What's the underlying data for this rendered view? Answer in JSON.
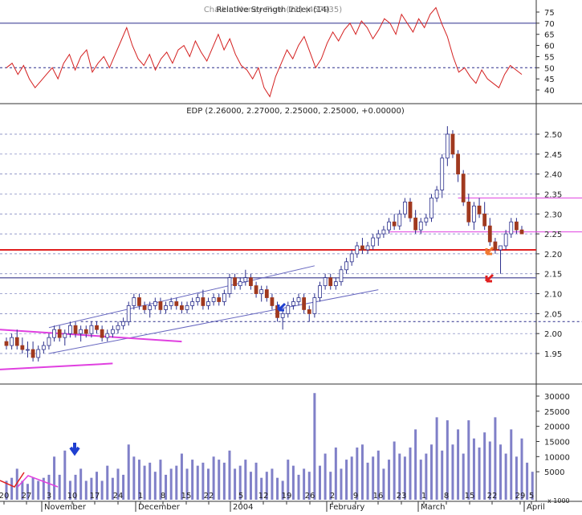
{
  "rsi_panel": {
    "title": "Relative Strength Index (14)",
    "title_overlay": "Chaikin Money Flow (21) (457935)",
    "ticks": [
      75,
      70,
      65,
      60,
      55,
      50,
      45,
      40
    ],
    "reference_levels": [
      70,
      50
    ]
  },
  "price_panel": {
    "title": "EDP (2.26000, 2.27000, 2.25000, 2.25000, +0.00000)",
    "ticks": [
      "2.50",
      "2.45",
      "2.40",
      "2.35",
      "2.30",
      "2.25",
      "2.20",
      "2.15",
      "2.10",
      "2.05",
      "2.00",
      "1.95"
    ],
    "support_level": 2.21,
    "secondary_level": 2.14
  },
  "volume_panel": {
    "ticks": [
      "30000",
      "25000",
      "20000",
      "15000",
      "10000",
      "5000"
    ],
    "multiplier_label": "x 1000"
  },
  "date_axis": {
    "day_labels": [
      "20",
      "27",
      "3",
      "10",
      "17",
      "24",
      "1",
      "8",
      "15",
      "22",
      "5",
      "12",
      "19",
      "26",
      "2",
      "9",
      "16",
      "23",
      "1",
      "8",
      "15",
      "22",
      "29",
      "5"
    ],
    "month_labels": [
      "November",
      "December",
      "2004",
      "February",
      "March",
      "April"
    ]
  },
  "colors": {
    "bull_body": "#ffffff",
    "bear_body": "#a0391f",
    "wick": "#2b2f8c",
    "rsi_line": "#d42020",
    "volume_bar": "#8080c8",
    "support_line": "#e02020",
    "channel_line": "#6868c0",
    "magenta_line": "#e040e0",
    "arrow_blue": "#1f3fd0",
    "arrow_orange": "#f07a30",
    "arrow_red": "#e02020"
  },
  "chart_data": [
    {
      "type": "candlestick",
      "name": "EDP",
      "x_unit": "trading day index (Oct 20, 2003 – Mar 31, 2004)",
      "ohlc": [
        [
          1.98,
          1.99,
          1.96,
          1.97
        ],
        [
          1.97,
          2.0,
          1.96,
          1.99
        ],
        [
          1.99,
          2.01,
          1.96,
          1.97
        ],
        [
          1.97,
          1.99,
          1.95,
          1.96
        ],
        [
          1.96,
          1.98,
          1.94,
          1.96
        ],
        [
          1.96,
          1.98,
          1.93,
          1.94
        ],
        [
          1.94,
          1.97,
          1.93,
          1.96
        ],
        [
          1.96,
          1.98,
          1.95,
          1.97
        ],
        [
          1.97,
          2.0,
          1.96,
          1.99
        ],
        [
          1.99,
          2.02,
          1.98,
          2.01
        ],
        [
          2.01,
          2.02,
          1.98,
          1.99
        ],
        [
          1.99,
          2.01,
          1.97,
          2.0
        ],
        [
          2.0,
          2.03,
          1.99,
          2.02
        ],
        [
          2.02,
          2.03,
          1.99,
          2.0
        ],
        [
          2.0,
          2.02,
          1.98,
          2.01
        ],
        [
          2.01,
          2.02,
          1.99,
          2.0
        ],
        [
          2.0,
          2.03,
          1.99,
          2.02
        ],
        [
          2.02,
          2.03,
          2.0,
          2.01
        ],
        [
          2.01,
          2.02,
          1.98,
          1.99
        ],
        [
          1.99,
          2.01,
          1.98,
          2.0
        ],
        [
          2.0,
          2.02,
          1.99,
          2.01
        ],
        [
          2.01,
          2.03,
          2.0,
          2.02
        ],
        [
          2.02,
          2.04,
          2.01,
          2.03
        ],
        [
          2.03,
          2.08,
          2.02,
          2.07
        ],
        [
          2.07,
          2.1,
          2.06,
          2.09
        ],
        [
          2.09,
          2.1,
          2.06,
          2.07
        ],
        [
          2.07,
          2.08,
          2.05,
          2.06
        ],
        [
          2.06,
          2.08,
          2.04,
          2.07
        ],
        [
          2.07,
          2.09,
          2.06,
          2.08
        ],
        [
          2.08,
          2.09,
          2.05,
          2.06
        ],
        [
          2.06,
          2.08,
          2.05,
          2.07
        ],
        [
          2.07,
          2.09,
          2.06,
          2.08
        ],
        [
          2.08,
          2.09,
          2.06,
          2.07
        ],
        [
          2.07,
          2.08,
          2.05,
          2.06
        ],
        [
          2.06,
          2.08,
          2.05,
          2.07
        ],
        [
          2.07,
          2.09,
          2.06,
          2.08
        ],
        [
          2.08,
          2.1,
          2.07,
          2.09
        ],
        [
          2.09,
          2.11,
          2.06,
          2.07
        ],
        [
          2.07,
          2.09,
          2.06,
          2.08
        ],
        [
          2.08,
          2.1,
          2.07,
          2.09
        ],
        [
          2.09,
          2.1,
          2.07,
          2.08
        ],
        [
          2.08,
          2.11,
          2.07,
          2.1
        ],
        [
          2.1,
          2.15,
          2.09,
          2.14
        ],
        [
          2.14,
          2.15,
          2.11,
          2.12
        ],
        [
          2.12,
          2.14,
          2.11,
          2.13
        ],
        [
          2.13,
          2.16,
          2.12,
          2.14
        ],
        [
          2.14,
          2.15,
          2.11,
          2.12
        ],
        [
          2.12,
          2.13,
          2.09,
          2.1
        ],
        [
          2.1,
          2.12,
          2.08,
          2.11
        ],
        [
          2.11,
          2.12,
          2.08,
          2.09
        ],
        [
          2.09,
          2.1,
          2.06,
          2.07
        ],
        [
          2.07,
          2.08,
          2.03,
          2.04
        ],
        [
          2.04,
          2.06,
          2.01,
          2.05
        ],
        [
          2.05,
          2.08,
          2.04,
          2.07
        ],
        [
          2.07,
          2.09,
          2.06,
          2.08
        ],
        [
          2.08,
          2.1,
          2.07,
          2.09
        ],
        [
          2.09,
          2.1,
          2.05,
          2.06
        ],
        [
          2.06,
          2.07,
          2.03,
          2.05
        ],
        [
          2.05,
          2.1,
          2.04,
          2.09
        ],
        [
          2.09,
          2.13,
          2.08,
          2.12
        ],
        [
          2.12,
          2.15,
          2.11,
          2.14
        ],
        [
          2.14,
          2.15,
          2.11,
          2.12
        ],
        [
          2.12,
          2.14,
          2.11,
          2.13
        ],
        [
          2.13,
          2.17,
          2.12,
          2.16
        ],
        [
          2.16,
          2.19,
          2.15,
          2.18
        ],
        [
          2.18,
          2.21,
          2.17,
          2.2
        ],
        [
          2.2,
          2.23,
          2.19,
          2.22
        ],
        [
          2.22,
          2.24,
          2.2,
          2.21
        ],
        [
          2.21,
          2.23,
          2.2,
          2.22
        ],
        [
          2.22,
          2.25,
          2.21,
          2.24
        ],
        [
          2.24,
          2.26,
          2.22,
          2.25
        ],
        [
          2.25,
          2.27,
          2.24,
          2.26
        ],
        [
          2.26,
          2.29,
          2.25,
          2.28
        ],
        [
          2.28,
          2.3,
          2.26,
          2.27
        ],
        [
          2.27,
          2.31,
          2.26,
          2.3
        ],
        [
          2.3,
          2.34,
          2.29,
          2.33
        ],
        [
          2.33,
          2.34,
          2.28,
          2.29
        ],
        [
          2.29,
          2.31,
          2.25,
          2.26
        ],
        [
          2.26,
          2.29,
          2.25,
          2.28
        ],
        [
          2.28,
          2.3,
          2.27,
          2.29
        ],
        [
          2.29,
          2.35,
          2.28,
          2.34
        ],
        [
          2.34,
          2.37,
          2.33,
          2.36
        ],
        [
          2.36,
          2.45,
          2.34,
          2.44
        ],
        [
          2.44,
          2.52,
          2.42,
          2.5
        ],
        [
          2.5,
          2.51,
          2.44,
          2.45
        ],
        [
          2.45,
          2.46,
          2.38,
          2.4
        ],
        [
          2.4,
          2.41,
          2.32,
          2.33
        ],
        [
          2.33,
          2.35,
          2.27,
          2.28
        ],
        [
          2.28,
          2.33,
          2.26,
          2.32
        ],
        [
          2.32,
          2.34,
          2.29,
          2.3
        ],
        [
          2.3,
          2.33,
          2.26,
          2.27
        ],
        [
          2.27,
          2.29,
          2.22,
          2.23
        ],
        [
          2.23,
          2.24,
          2.2,
          2.21
        ],
        [
          2.21,
          2.22,
          2.15,
          2.22
        ],
        [
          2.22,
          2.26,
          2.21,
          2.25
        ],
        [
          2.25,
          2.29,
          2.24,
          2.28
        ],
        [
          2.28,
          2.29,
          2.25,
          2.26
        ],
        [
          2.26,
          2.27,
          2.25,
          2.25
        ]
      ]
    },
    {
      "type": "line",
      "name": "Relative Strength Index (14)",
      "ylim": [
        35,
        77
      ],
      "values": [
        50,
        52,
        47,
        51,
        45,
        41,
        44,
        47,
        50,
        45,
        52,
        56,
        49,
        55,
        58,
        48,
        52,
        55,
        50,
        56,
        62,
        68,
        60,
        54,
        51,
        56,
        49,
        54,
        57,
        52,
        58,
        60,
        55,
        62,
        57,
        53,
        59,
        65,
        58,
        63,
        56,
        51,
        49,
        45,
        50,
        41,
        37,
        46,
        52,
        58,
        54,
        60,
        64,
        57,
        50,
        54,
        61,
        66,
        62,
        67,
        70,
        65,
        71,
        68,
        63,
        67,
        72,
        70,
        65,
        74,
        70,
        66,
        72,
        68,
        74,
        77,
        70,
        64,
        55,
        48,
        50,
        46,
        43,
        49,
        45,
        43,
        41,
        47,
        51,
        49,
        47
      ]
    },
    {
      "type": "bar",
      "name": "Volume",
      "y_unit": "thousands",
      "ylim": [
        0,
        33000
      ],
      "values": [
        2000,
        3000,
        6000,
        2000,
        1000,
        3000,
        2000,
        3000,
        4000,
        10000,
        4000,
        12000,
        2000,
        4000,
        6000,
        2000,
        3000,
        5000,
        2000,
        7000,
        3000,
        6000,
        4000,
        14000,
        10000,
        9000,
        7000,
        8000,
        5000,
        9000,
        4000,
        6000,
        7000,
        11000,
        6000,
        9000,
        7000,
        8000,
        6000,
        10000,
        9000,
        8000,
        12000,
        6000,
        7000,
        9000,
        5000,
        8000,
        3000,
        5000,
        6000,
        3000,
        2000,
        9000,
        7000,
        4000,
        6000,
        5000,
        31000,
        7000,
        11000,
        5000,
        13000,
        6000,
        9000,
        10000,
        13000,
        14000,
        8000,
        10000,
        12000,
        6000,
        9000,
        15000,
        11000,
        10000,
        13000,
        19000,
        9000,
        11000,
        14000,
        23000,
        12000,
        22000,
        14000,
        19000,
        11000,
        22000,
        16000,
        13000,
        18000,
        15000,
        23000,
        14000,
        11000,
        19000,
        10000,
        16000,
        8000,
        5000
      ]
    }
  ]
}
